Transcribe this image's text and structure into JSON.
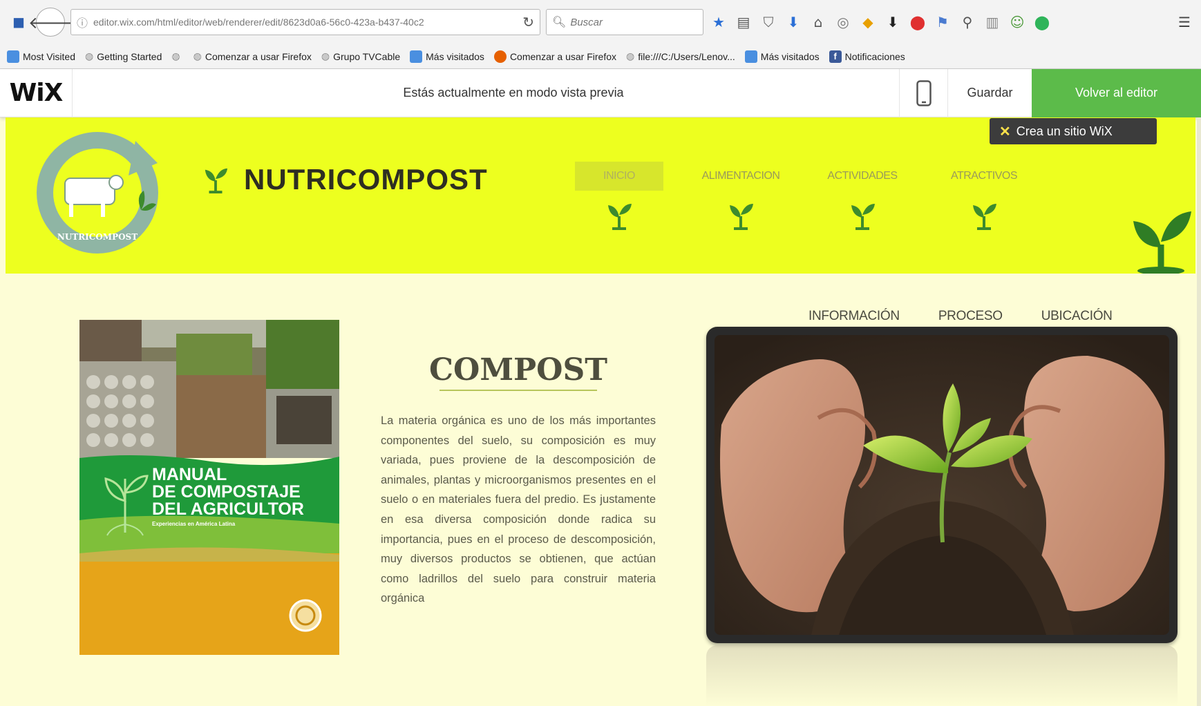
{
  "browser": {
    "url": "editor.wix.com/html/editor/web/renderer/edit/8623d0a6-56c0-423a-b437-40c2",
    "url_host": "wix.com",
    "search_placeholder": "Buscar",
    "bookmarks": [
      {
        "label": "Most Visited",
        "icon": "folder-icon",
        "color": "#4a8fe0"
      },
      {
        "label": "Getting Started",
        "icon": "globe-icon",
        "color": "#8a8a8a"
      },
      {
        "label": "",
        "icon": "globe-icon",
        "color": "#8a8a8a"
      },
      {
        "label": "Comenzar a usar Firefox",
        "icon": "globe-icon",
        "color": "#8a8a8a"
      },
      {
        "label": "Grupo TVCable",
        "icon": "globe-icon",
        "color": "#8a8a8a"
      },
      {
        "label": "Más visitados",
        "icon": "folder-icon",
        "color": "#4a8fe0"
      },
      {
        "label": "Comenzar a usar Firefox",
        "icon": "firefox-icon",
        "color": "#e66000"
      },
      {
        "label": "file:///C:/Users/Lenov...",
        "icon": "globe-icon",
        "color": "#8a8a8a"
      },
      {
        "label": "Más visitados",
        "icon": "folder-icon",
        "color": "#4a8fe0"
      },
      {
        "label": "Notificaciones",
        "icon": "facebook-icon",
        "color": "#3b5998"
      }
    ]
  },
  "wixbar": {
    "logo": "WiX",
    "preview_message": "Estás actualmente en modo vista previa",
    "save_label": "Guardar",
    "back_label": "Volver al editor",
    "accent": "#5cbb4a"
  },
  "site": {
    "badge_label": "Crea un sitio WiX",
    "logo_text": "NUTRICOMPOST",
    "brand_name": "NUTRICOMPOST",
    "header_color": "#edff1f",
    "nav": [
      {
        "label": "INICIO",
        "active": true
      },
      {
        "label": "ALIMENTACION",
        "active": false
      },
      {
        "label": "ACTIVIDADES",
        "active": false
      },
      {
        "label": "ATRACTIVOS",
        "active": false
      }
    ],
    "subnav": [
      "INFORMACIÓN",
      "PROCESO",
      "UBICACIÓN"
    ]
  },
  "book": {
    "title_line1": "MANUAL",
    "title_line2": "DE COMPOSTAJE",
    "title_line3": "DEL AGRICULTOR",
    "subtitle": "Experiencias en América Latina"
  },
  "content": {
    "title": "COMPOST",
    "body": "La materia orgánica es uno de los más importantes componentes del suelo, su composición es muy variada, pues proviene de la descomposición de animales, plantas y microorganismos presentes en el suelo o en materiales fuera del predio. Es justamente en esa diversa composición donde radica su importancia, pues en el proceso de descomposición, muy diversos productos se obtienen, que actúan como ladrillos del suelo para construir materia orgánica"
  }
}
